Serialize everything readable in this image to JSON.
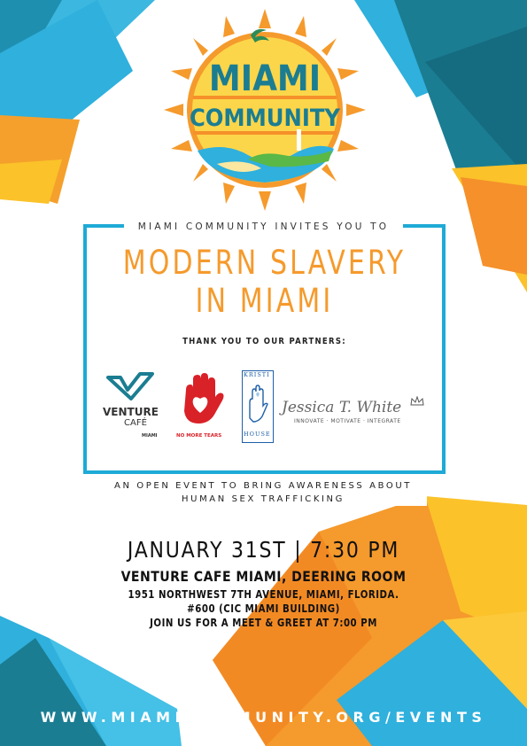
{
  "logo": {
    "line1": "MIAMI",
    "line2": "COMMUNITY"
  },
  "invite": "MIAMI COMMUNITY INVITES YOU TO",
  "title": {
    "line1": "MODERN SLAVERY",
    "line2": "IN MIAMI"
  },
  "partners_label": "THANK YOU TO OUR PARTNERS:",
  "partners": {
    "venture": {
      "name": "VENTURE",
      "sub": "CAFÉ",
      "city": "MIAMI"
    },
    "nomoretears": {
      "text": "NO MORE TEARS"
    },
    "kristi": {
      "top": "KRISTI",
      "bottom": "HOUSE"
    },
    "jessica": {
      "name": "Jessica T. White",
      "tagline": "INNOVATE · MOTIVATE · INTEGRATE"
    }
  },
  "subtitle": {
    "line1": "AN OPEN EVENT TO BRING AWARENESS ABOUT",
    "line2": "HUMAN SEX TRAFFICKING"
  },
  "date_time": "JANUARY 31ST | 7:30 PM",
  "venue": "VENTURE CAFE MIAMI, DEERING ROOM",
  "address": {
    "line1": "1951 NORTHWEST 7TH AVENUE, MIAMI, FLORIDA.",
    "line2": "#600 (CIC MIAMI BUILDING)",
    "line3": "JOIN US FOR A MEET & GREET AT 7:00 PM"
  },
  "website": "WWW.MIAMICOMMUNITY.ORG/EVENTS",
  "colors": {
    "orange": "#f59a2c",
    "blue": "#1eaad6",
    "teal": "#157a8e",
    "yellow": "#fbc22a"
  }
}
